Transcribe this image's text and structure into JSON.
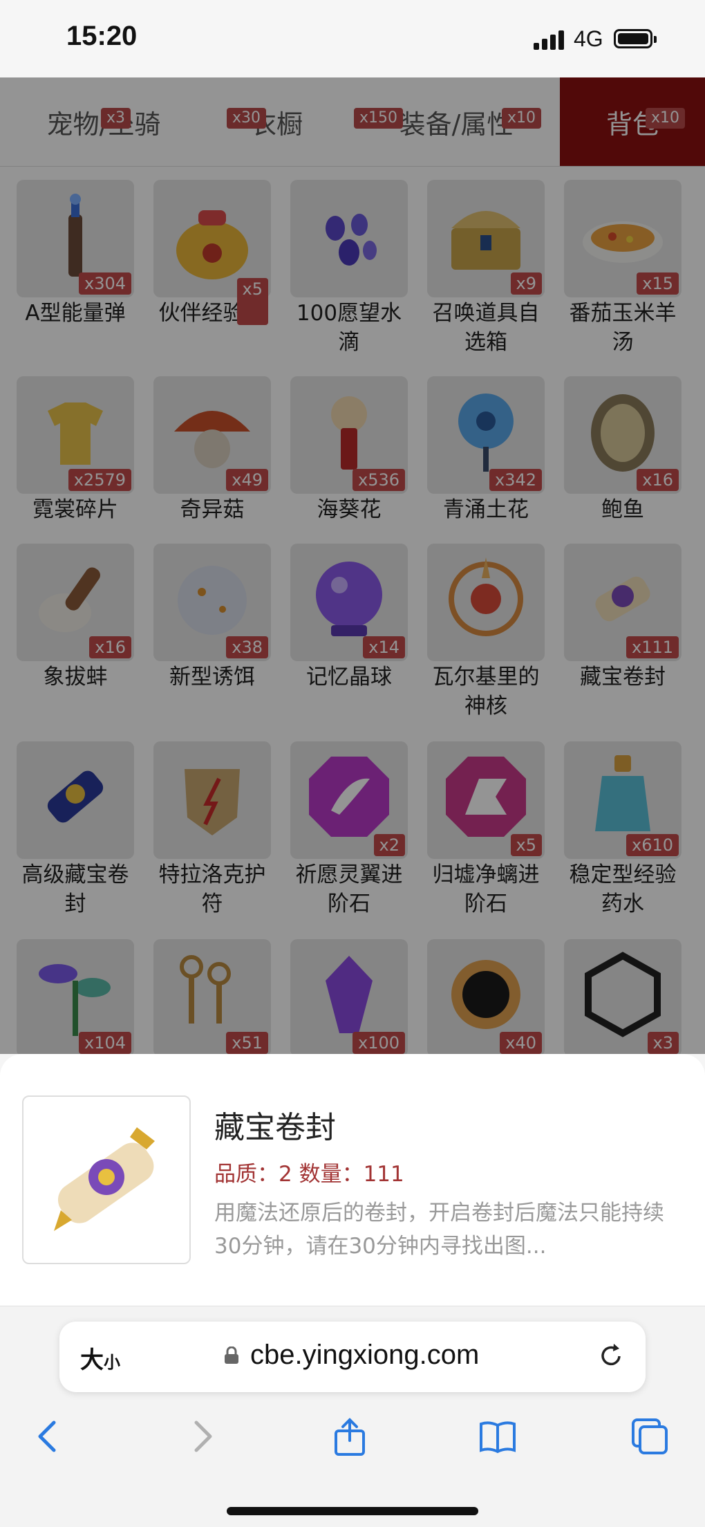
{
  "status_bar": {
    "time": "15:20",
    "network": "4G"
  },
  "tabs": [
    {
      "label": "宠物/坐骑",
      "badge": "x3",
      "active": false
    },
    {
      "label": "衣橱",
      "badge": "x30",
      "active": false
    },
    {
      "label": "装备/属性",
      "badge": "x150",
      "active": false
    },
    {
      "label": "背包",
      "badge": "x10",
      "active": true
    }
  ],
  "extra_badge": "x10",
  "items": [
    {
      "name": "A型能量弹",
      "count": "x304",
      "icon": "energy-bullet-icon"
    },
    {
      "name": "伙伴经验粮",
      "count": "x5",
      "icon": "exp-food-bag-icon"
    },
    {
      "name": "100愿望水滴",
      "count": "",
      "icon": "wish-drops-icon"
    },
    {
      "name": "召唤道具自选箱",
      "count": "x9",
      "icon": "treasure-chest-icon"
    },
    {
      "name": "番茄玉米羊汤",
      "count": "x15",
      "icon": "soup-bowl-icon"
    },
    {
      "name": "霓裳碎片",
      "count": "x2579",
      "icon": "shirt-fragment-icon"
    },
    {
      "name": "奇异菇",
      "count": "x49",
      "icon": "mushroom-icon"
    },
    {
      "name": "海葵花",
      "count": "x536",
      "icon": "anemone-flower-icon"
    },
    {
      "name": "青涌土花",
      "count": "x342",
      "icon": "blue-flower-icon"
    },
    {
      "name": "鲍鱼",
      "count": "x16",
      "icon": "abalone-icon"
    },
    {
      "name": "象拔蚌",
      "count": "x16",
      "icon": "geoduck-icon"
    },
    {
      "name": "新型诱饵",
      "count": "x38",
      "icon": "bait-ball-icon"
    },
    {
      "name": "记忆晶球",
      "count": "x14",
      "icon": "crystal-ball-icon"
    },
    {
      "name": "瓦尔基里的神核",
      "count": "",
      "icon": "divine-core-icon"
    },
    {
      "name": "藏宝卷封",
      "count": "x111",
      "icon": "treasure-scroll-icon"
    },
    {
      "name": "高级藏宝卷封",
      "count": "",
      "icon": "advanced-scroll-icon"
    },
    {
      "name": "特拉洛克护符",
      "count": "",
      "icon": "amulet-icon"
    },
    {
      "name": "祈愿灵翼进阶石",
      "count": "x2",
      "icon": "wing-stone-icon"
    },
    {
      "name": "归墟净螭进阶石",
      "count": "x5",
      "icon": "dragon-stone-icon"
    },
    {
      "name": "稳定型经验药水",
      "count": "x610",
      "icon": "exp-potion-icon"
    },
    {
      "name": "",
      "count": "x104",
      "icon": "plant-icon"
    },
    {
      "name": "",
      "count": "x51",
      "icon": "keys-icon"
    },
    {
      "name": "",
      "count": "x100",
      "icon": "purple-crystal-icon"
    },
    {
      "name": "",
      "count": "x40",
      "icon": "black-sun-icon"
    },
    {
      "name": "",
      "count": "x3",
      "icon": "cage-icon"
    }
  ],
  "detail": {
    "title": "藏宝卷封",
    "meta": "品质：2   数量：111",
    "description": "用魔法还原后的卷封，开启卷封后魔法只能持续30分钟，请在30分钟内寻找出图..."
  },
  "browser": {
    "text_size_label": "大",
    "text_size_small": "小",
    "url": "cbe.yingxiong.com"
  }
}
